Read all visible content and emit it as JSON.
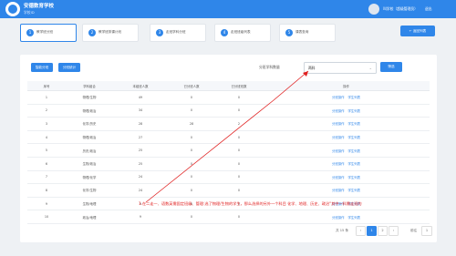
{
  "header": {
    "brand_name": "安德数育学校",
    "brand_sub": "学校ID",
    "user_text": "叫学校（超级管理员）",
    "logout": "退出"
  },
  "steps": [
    {
      "num": "1",
      "label": "教学班分班"
    },
    {
      "num": "2",
      "label": "教学班排课计划"
    },
    {
      "num": "3",
      "label": "走班学科分班"
    },
    {
      "num": "4",
      "label": "走班班级列表"
    },
    {
      "num": "5",
      "label": "课表查询"
    }
  ],
  "return_button": "← 返回列表",
  "toolbar": {
    "btn1": "智能分班",
    "btn2": "分班统计",
    "filter_label": "分班学科数量",
    "select_value": "两科",
    "query_button": "筛选"
  },
  "table": {
    "headers": [
      "序号",
      "学科组合",
      "本组班人数",
      "已分班人数",
      "已分班班数",
      "操作"
    ],
    "op_links": [
      "分班操作",
      "学生列表"
    ],
    "rows": [
      {
        "no": "1",
        "combo": "物理/生物",
        "total": "49",
        "assigned": "0",
        "classes": "0"
      },
      {
        "no": "2",
        "combo": "物理/政治",
        "total": "34",
        "assigned": "0",
        "classes": "0"
      },
      {
        "no": "3",
        "combo": "化学/历史",
        "total": "28",
        "assigned": "28",
        "classes": "2"
      },
      {
        "no": "4",
        "combo": "物理/政治",
        "total": "27",
        "assigned": "0",
        "classes": "0"
      },
      {
        "no": "5",
        "combo": "历史/政治",
        "total": "25",
        "assigned": "0",
        "classes": "0"
      },
      {
        "no": "6",
        "combo": "生物/政治",
        "total": "25",
        "assigned": "0",
        "classes": "0"
      },
      {
        "no": "7",
        "combo": "物理/化学",
        "total": "24",
        "assigned": "0",
        "classes": "0"
      },
      {
        "no": "8",
        "combo": "化学/生物",
        "total": "24",
        "assigned": "0",
        "classes": "0"
      },
      {
        "no": "9",
        "combo": "生物/地理",
        "total": "9",
        "assigned": "0",
        "classes": "0"
      },
      {
        "no": "10",
        "combo": "政治/地理",
        "total": "9",
        "assigned": "0",
        "classes": "0"
      }
    ]
  },
  "pager": {
    "total": "共 15 条",
    "prev": "‹",
    "page1": "1",
    "page2": "2",
    "next": "›",
    "goto": "前往",
    "current": "1"
  },
  "annotation": "1.在二走一、语数英需固定班级、管理:选了物理/生物的学生，那么选择的另外一个科目 化学、地理、历史、政治\"其中一科需走班的",
  "colors": {
    "primary": "#2f86e9",
    "annotation": "#e02020",
    "background": "#eef1f4"
  }
}
